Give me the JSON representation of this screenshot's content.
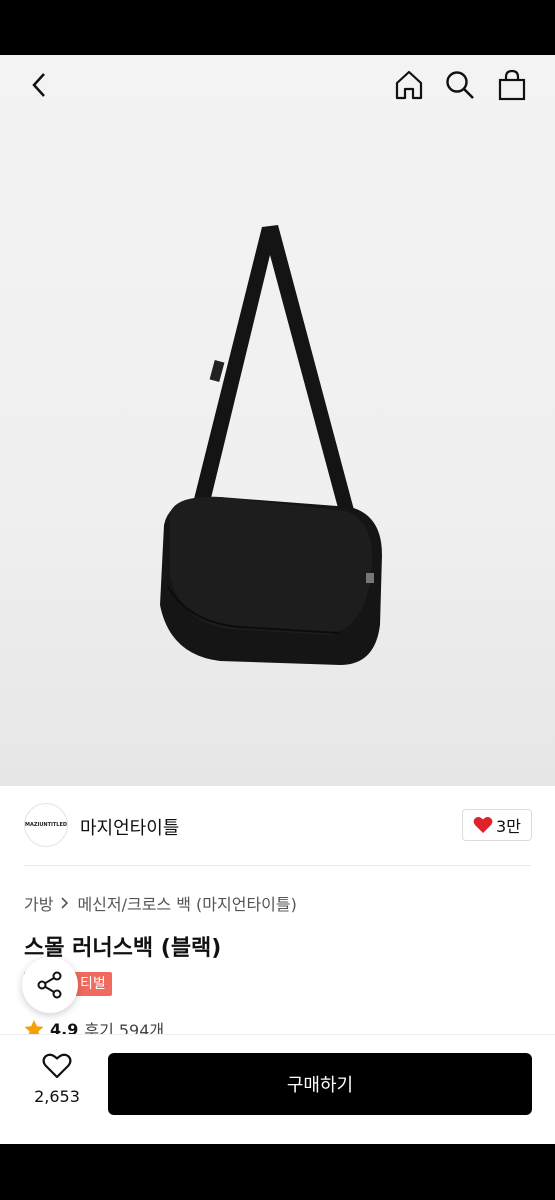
{
  "header": {
    "back_icon": "chevron-left-icon",
    "home_icon": "home-icon",
    "search_icon": "search-icon",
    "cart_icon": "shopping-bag-icon"
  },
  "product_image": {
    "subject": "black small messenger bag",
    "background_color": "#f0f0f0"
  },
  "brand": {
    "logo_text": "MAZIUNTITLED",
    "name": "마지언타이틀",
    "like_count": "3만",
    "like_color": "#e0202a"
  },
  "breadcrumb": {
    "category": "가방",
    "separator": ">",
    "subcategory": "메신저/크로스 백 (마지언타이틀)"
  },
  "product": {
    "title": "스몰 러너스백 (블랙)",
    "tag_label": "티벌",
    "tag_color": "#f06b5d",
    "rating": "4.9",
    "review_label": "후기 594개"
  },
  "actions": {
    "wish_count": "2,653",
    "buy_label": "구매하기"
  }
}
